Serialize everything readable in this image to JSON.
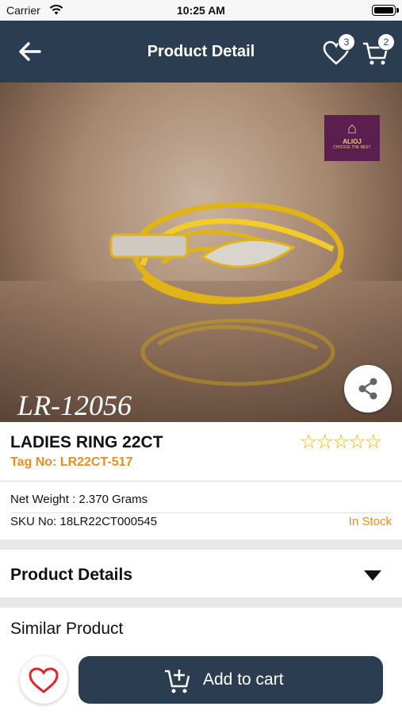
{
  "status_bar": {
    "carrier": "Carrier",
    "time": "10:25 AM"
  },
  "navbar": {
    "title": "Product Detail",
    "wishlist_count": "3",
    "cart_count": "2"
  },
  "hero": {
    "brand_line1": "ALIOJ",
    "brand_line2": "CHOOSE THE BEST",
    "design_code": "LR-12056"
  },
  "product": {
    "name": "LADIES RING 22CT",
    "tag": "Tag No: LR22CT-517",
    "rating": 0,
    "rating_max": 5,
    "stars": "☆☆☆☆☆",
    "net_weight": "Net Weight : 2.370 Grams",
    "sku": "SKU No: 18LR22CT000545",
    "stock_status": "In Stock"
  },
  "sections": {
    "details_label": "Product Details",
    "similar_label": "Similar Product"
  },
  "actions": {
    "add_to_cart_label": "Add to cart"
  },
  "colors": {
    "navbar": "#2b3d50",
    "accent": "#f08c1c",
    "star": "#f4b400",
    "favorite": "#e0242c"
  }
}
